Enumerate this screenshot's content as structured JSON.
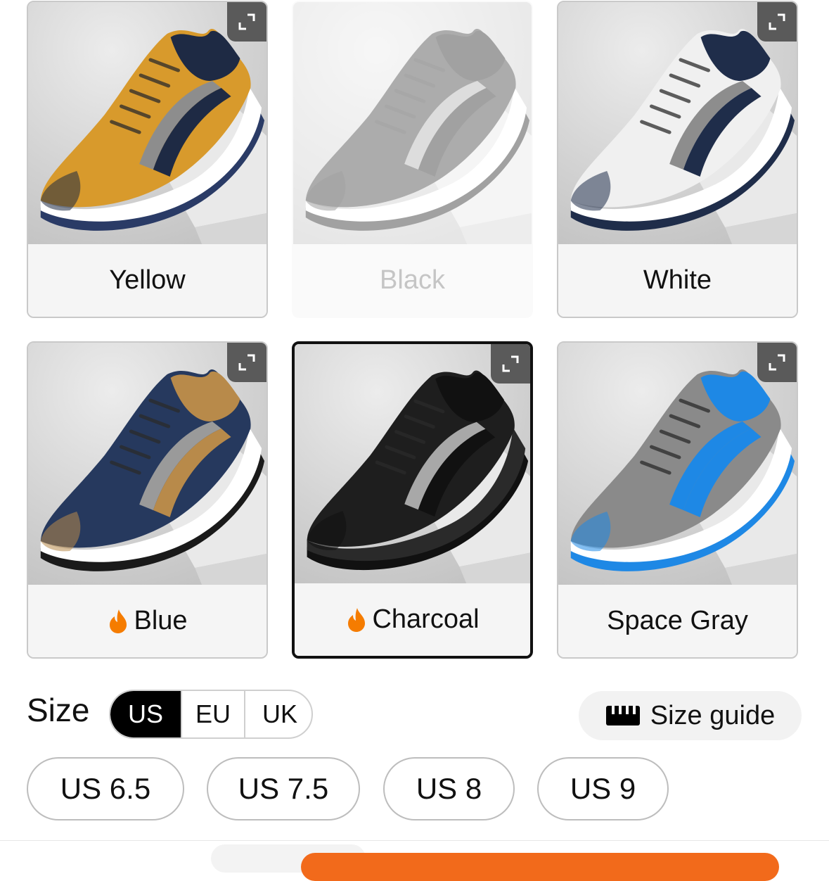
{
  "variants": [
    {
      "label": "Yellow",
      "state": "normal",
      "hot": false,
      "colors": {
        "upper": "#d89a2c",
        "accent": "#1e2a44",
        "stripe": "#8d8d8d",
        "sole": "#ffffff",
        "outsole": "#2a3b66"
      },
      "icon": "expand-icon"
    },
    {
      "label": "Black",
      "state": "disabled",
      "hot": false,
      "colors": {
        "upper": "#3b3b3b",
        "accent": "#222222",
        "stripe": "#b0b0b0",
        "sole": "#ffffff",
        "outsole": "#222222"
      },
      "icon": "expand-icon"
    },
    {
      "label": "White",
      "state": "normal",
      "hot": false,
      "colors": {
        "upper": "#f0f0f0",
        "accent": "#1f2d4a",
        "stripe": "#8d8d8d",
        "sole": "#ffffff",
        "outsole": "#1f2d4a"
      },
      "icon": "expand-icon"
    },
    {
      "label": "Blue",
      "state": "normal",
      "hot": true,
      "colors": {
        "upper": "#26395e",
        "accent": "#b88a4a",
        "stripe": "#9a9a9a",
        "sole": "#ffffff",
        "outsole": "#1a1a1a"
      },
      "icon": "expand-icon"
    },
    {
      "label": "Charcoal",
      "state": "selected",
      "hot": true,
      "colors": {
        "upper": "#1e1e1e",
        "accent": "#111111",
        "stripe": "#a8a8a8",
        "sole": "#2a2a2a",
        "outsole": "#111111"
      },
      "icon": "expand-icon"
    },
    {
      "label": "Space Gray",
      "state": "normal",
      "hot": false,
      "colors": {
        "upper": "#8a8a8a",
        "accent": "#1e88e5",
        "stripe": "#1e88e5",
        "sole": "#ffffff",
        "outsole": "#1e88e5"
      },
      "icon": "expand-icon"
    }
  ],
  "size_section": {
    "title": "Size",
    "units": [
      "US",
      "EU",
      "UK"
    ],
    "selected_unit": "US",
    "size_guide_label": "Size guide",
    "size_guide_icon": "ruler-icon",
    "options": [
      "US 6.5",
      "US 7.5",
      "US 8",
      "US 9"
    ]
  },
  "colors": {
    "hot_icon": "#f57c00",
    "cta": "#f26a1b"
  }
}
